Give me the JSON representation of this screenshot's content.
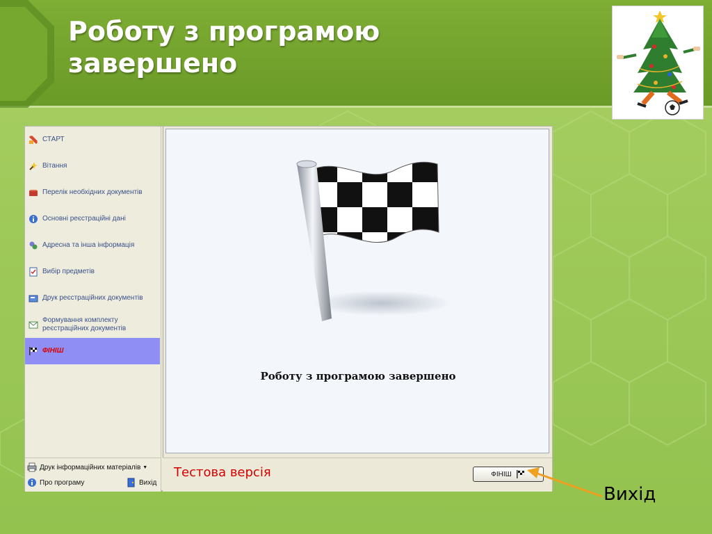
{
  "slide": {
    "title_line1": "Роботу з програмою",
    "title_line2": "завершено",
    "exit_callout": "Вихід"
  },
  "sidebar": {
    "items": [
      {
        "label": "СТАРТ",
        "icon": "start-icon"
      },
      {
        "label": "Вітання",
        "icon": "greeting-icon"
      },
      {
        "label": "Перелік необхідних документів",
        "icon": "documents-list-icon"
      },
      {
        "label": "Основні реєстраційні дані",
        "icon": "info-icon"
      },
      {
        "label": "Адресна та інша інформація",
        "icon": "address-icon"
      },
      {
        "label": "Вибір предметів",
        "icon": "checklist-icon"
      },
      {
        "label": "Друк реєстраційних документів",
        "icon": "print-documents-icon"
      },
      {
        "label_line1": "Формування комплекту",
        "label_line2": "реєстраційних документів",
        "icon": "envelope-icon"
      },
      {
        "label": "ФІНІШ",
        "icon": "checkered-flag-icon",
        "active": true
      }
    ]
  },
  "bottom_left": {
    "print_materials": "Друк інформаційних матеріалів",
    "about": "Про програму",
    "exit": "Вихід"
  },
  "content": {
    "message": "Роботу з програмою завершено"
  },
  "bottom_bar": {
    "test_version": "Тестова версія",
    "finish_button": "ФІНІШ"
  },
  "colors": {
    "slide_green": "#9fca5a",
    "header_green": "#7fae35",
    "active_nav": "#8f8ef5",
    "active_text": "#d80000",
    "test_version": "#d40000",
    "arrow": "#f0a020"
  }
}
